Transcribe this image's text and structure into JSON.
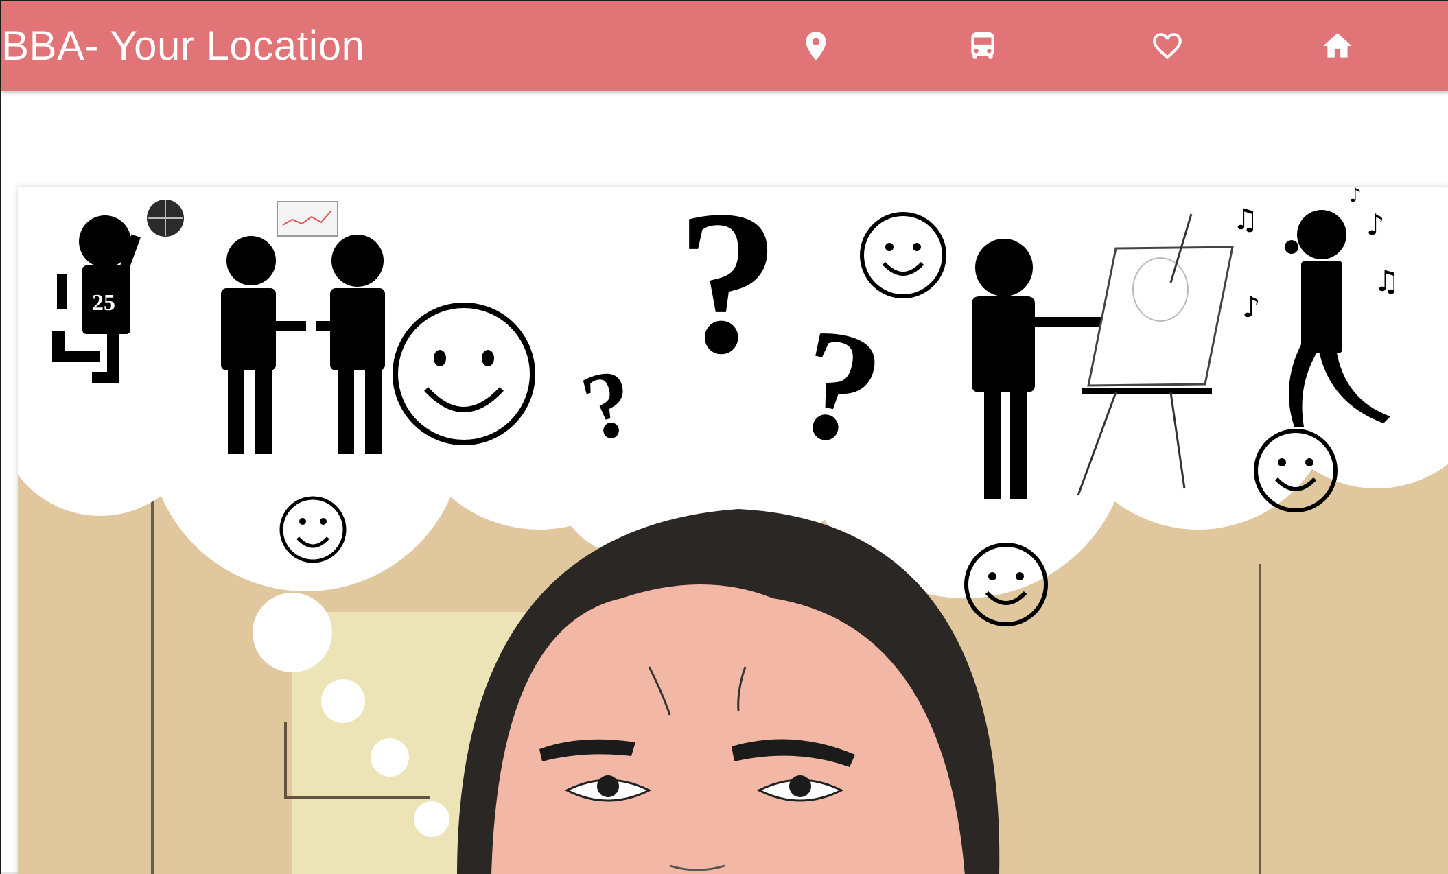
{
  "app": {
    "title": "BBA- Your Location"
  },
  "nav": {
    "items": [
      {
        "icon": "location-pin-icon"
      },
      {
        "icon": "bus-icon"
      },
      {
        "icon": "heart-icon"
      },
      {
        "icon": "home-icon"
      }
    ]
  },
  "hero": {
    "jersey_number": "25"
  },
  "colors": {
    "appbar": "#e07477",
    "wall": "#e0c79e",
    "hair": "#2a2725",
    "skin": "#f2b8a5"
  }
}
